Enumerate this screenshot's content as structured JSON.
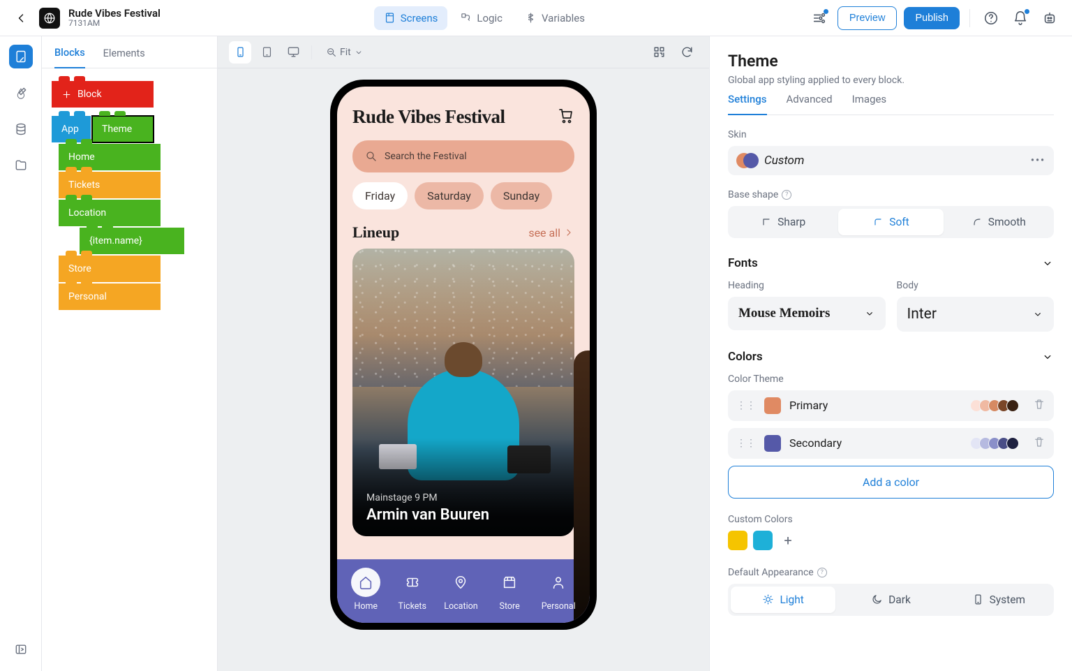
{
  "app": {
    "title": "Rude Vibes Festival",
    "subtitle": "7131AM"
  },
  "topnav": {
    "screens": "Screens",
    "logic": "Logic",
    "variables": "Variables",
    "preview": "Preview",
    "publish": "Publish"
  },
  "leftpanel": {
    "tabs": {
      "blocks": "Blocks",
      "elements": "Elements"
    }
  },
  "blocks": {
    "add": "Block",
    "app": "App",
    "theme": "Theme",
    "items": [
      "Home",
      "Tickets",
      "Location",
      "{item.name}",
      "Store",
      "Personal"
    ]
  },
  "zoom": "Fit",
  "phone": {
    "title": "Rude Vibes Festival",
    "search_placeholder": "Search the Festival",
    "days": [
      "Friday",
      "Saturday",
      "Sunday"
    ],
    "section": "Lineup",
    "see_all": "see all",
    "card": {
      "stage": "Mainstage 9 PM",
      "artist": "Armin van Buuren"
    },
    "tabs": [
      "Home",
      "Tickets",
      "Location",
      "Store",
      "Personal"
    ]
  },
  "theme": {
    "title": "Theme",
    "subtitle": "Global app styling applied to every block.",
    "tabs": [
      "Settings",
      "Advanced",
      "Images"
    ],
    "skin_label": "Skin",
    "skin_name": "Custom",
    "base_shape_label": "Base shape",
    "shapes": [
      "Sharp",
      "Soft",
      "Smooth"
    ],
    "fonts_label": "Fonts",
    "heading_label": "Heading",
    "body_label": "Body",
    "heading_font": "Mouse Memoirs",
    "body_font": "Inter",
    "colors_label": "Colors",
    "color_theme_label": "Color Theme",
    "primary": "Primary",
    "secondary": "Secondary",
    "primary_color": "#e08a63",
    "secondary_color": "#5559a8",
    "primary_shades": [
      "#fce0d7",
      "#f0b9a2",
      "#d68a63",
      "#7a4628",
      "#3a2213"
    ],
    "secondary_shades": [
      "#e3e5f5",
      "#b6bae0",
      "#8a8fc9",
      "#4a4e87",
      "#1e2140"
    ],
    "add_color": "Add a color",
    "custom_colors_label": "Custom Colors",
    "custom_colors": [
      "#f5c400",
      "#1eb0d8"
    ],
    "default_appearance_label": "Default Appearance",
    "appearances": [
      "Light",
      "Dark",
      "System"
    ]
  }
}
